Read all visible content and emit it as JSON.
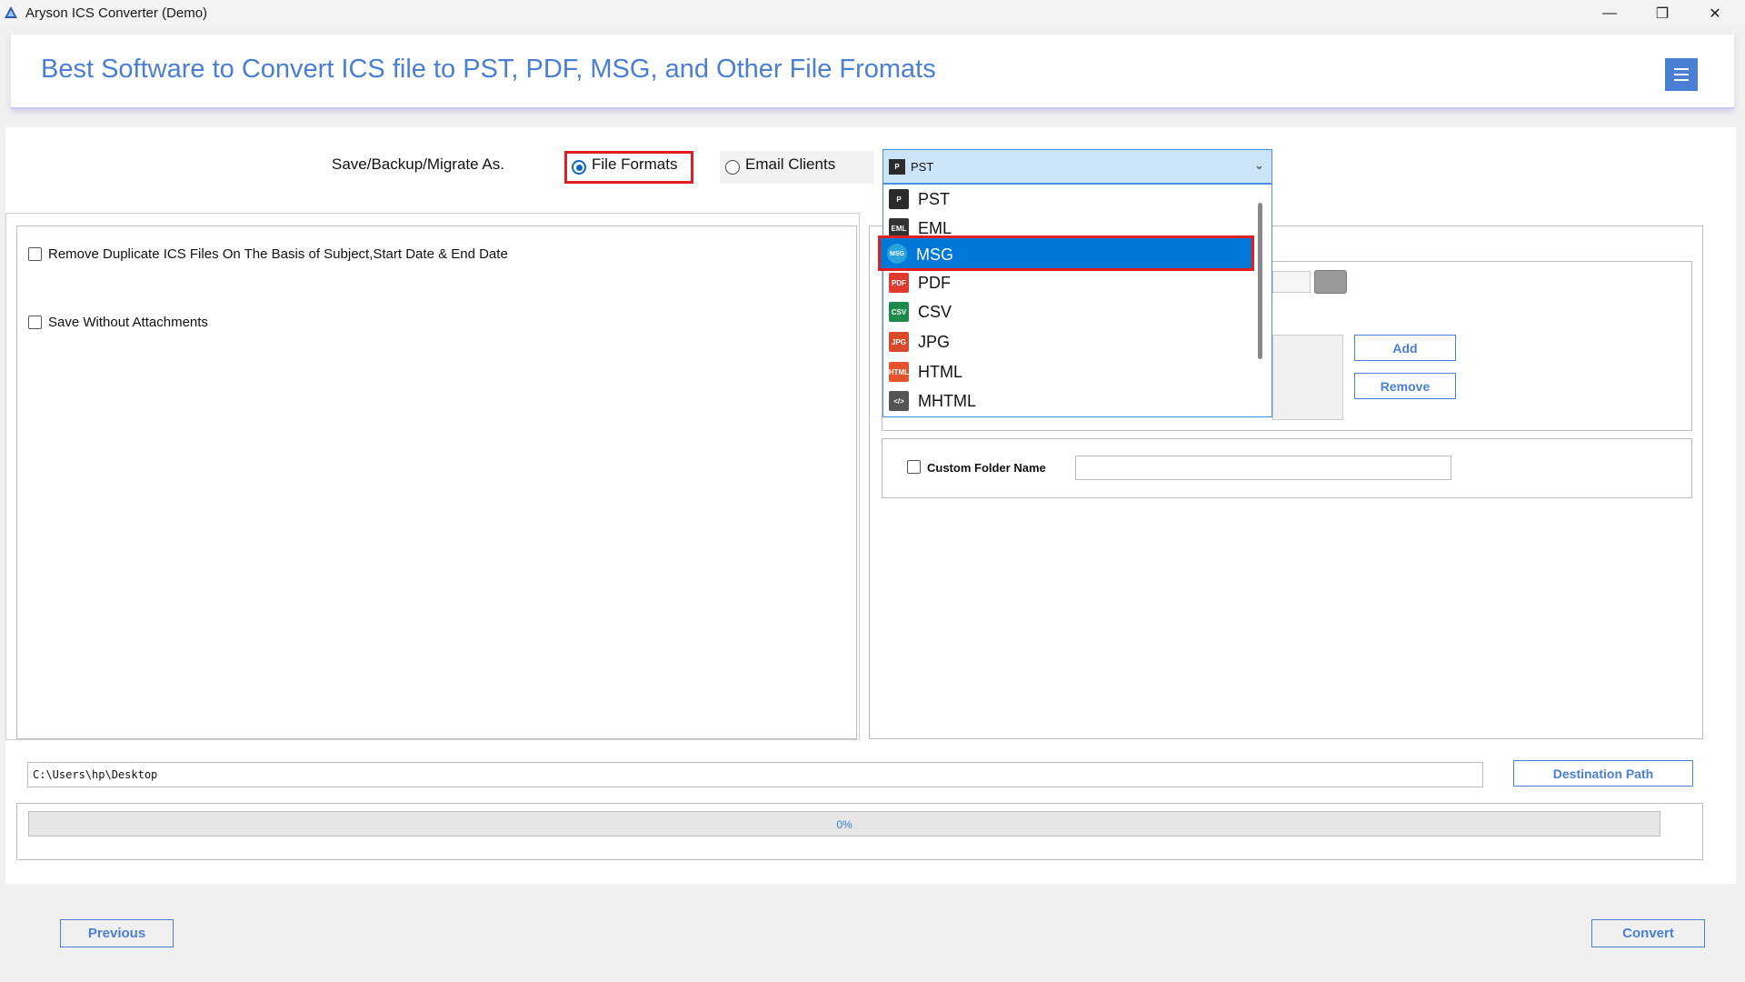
{
  "window": {
    "title": "Aryson ICS Converter (Demo)",
    "minimize": "—",
    "maximize": "❐",
    "close": "✕"
  },
  "header": {
    "title": "Best Software to Convert ICS file to PST, PDF, MSG, and Other File Fromats"
  },
  "save_as": {
    "label": "Save/Backup/Migrate As.",
    "options": [
      {
        "label": "File Formats",
        "selected": true
      },
      {
        "label": "Email Clients",
        "selected": false
      }
    ]
  },
  "format_select": {
    "value": "PST",
    "options": [
      {
        "label": "PST",
        "icon": "pst-icon",
        "color": "#2b2b2b"
      },
      {
        "label": "EML",
        "icon": "eml-icon",
        "color": "#333333"
      },
      {
        "label": "MSG",
        "icon": "msg-icon",
        "color": "#2aa3e0"
      },
      {
        "label": "PDF",
        "icon": "pdf-icon",
        "color": "#e03a2f"
      },
      {
        "label": "CSV",
        "icon": "csv-icon",
        "color": "#1d8a4c"
      },
      {
        "label": "JPG",
        "icon": "jpg-icon",
        "color": "#d84a2a"
      },
      {
        "label": "HTML",
        "icon": "html-icon",
        "color": "#e5532d"
      },
      {
        "label": "MHTML",
        "icon": "mhtml-icon",
        "color": "#555555"
      }
    ],
    "highlighted": "MSG"
  },
  "options": {
    "remove_duplicates": "Remove Duplicate ICS Files On The Basis of Subject,Start Date & End Date",
    "save_without_attachments": "Save Without Attachments"
  },
  "right_panel": {
    "add_label": "Add",
    "remove_label": "Remove",
    "custom_folder_label": "Custom Folder Name",
    "custom_folder_value": ""
  },
  "destination": {
    "path": "C:\\Users\\hp\\Desktop",
    "button": "Destination Path"
  },
  "progress": {
    "value": 0,
    "label": "0%"
  },
  "footer": {
    "previous": "Previous",
    "convert": "Convert"
  },
  "colors": {
    "accent": "#4a7fd4",
    "highlight": "#0078d7",
    "callout": "#e02020"
  }
}
